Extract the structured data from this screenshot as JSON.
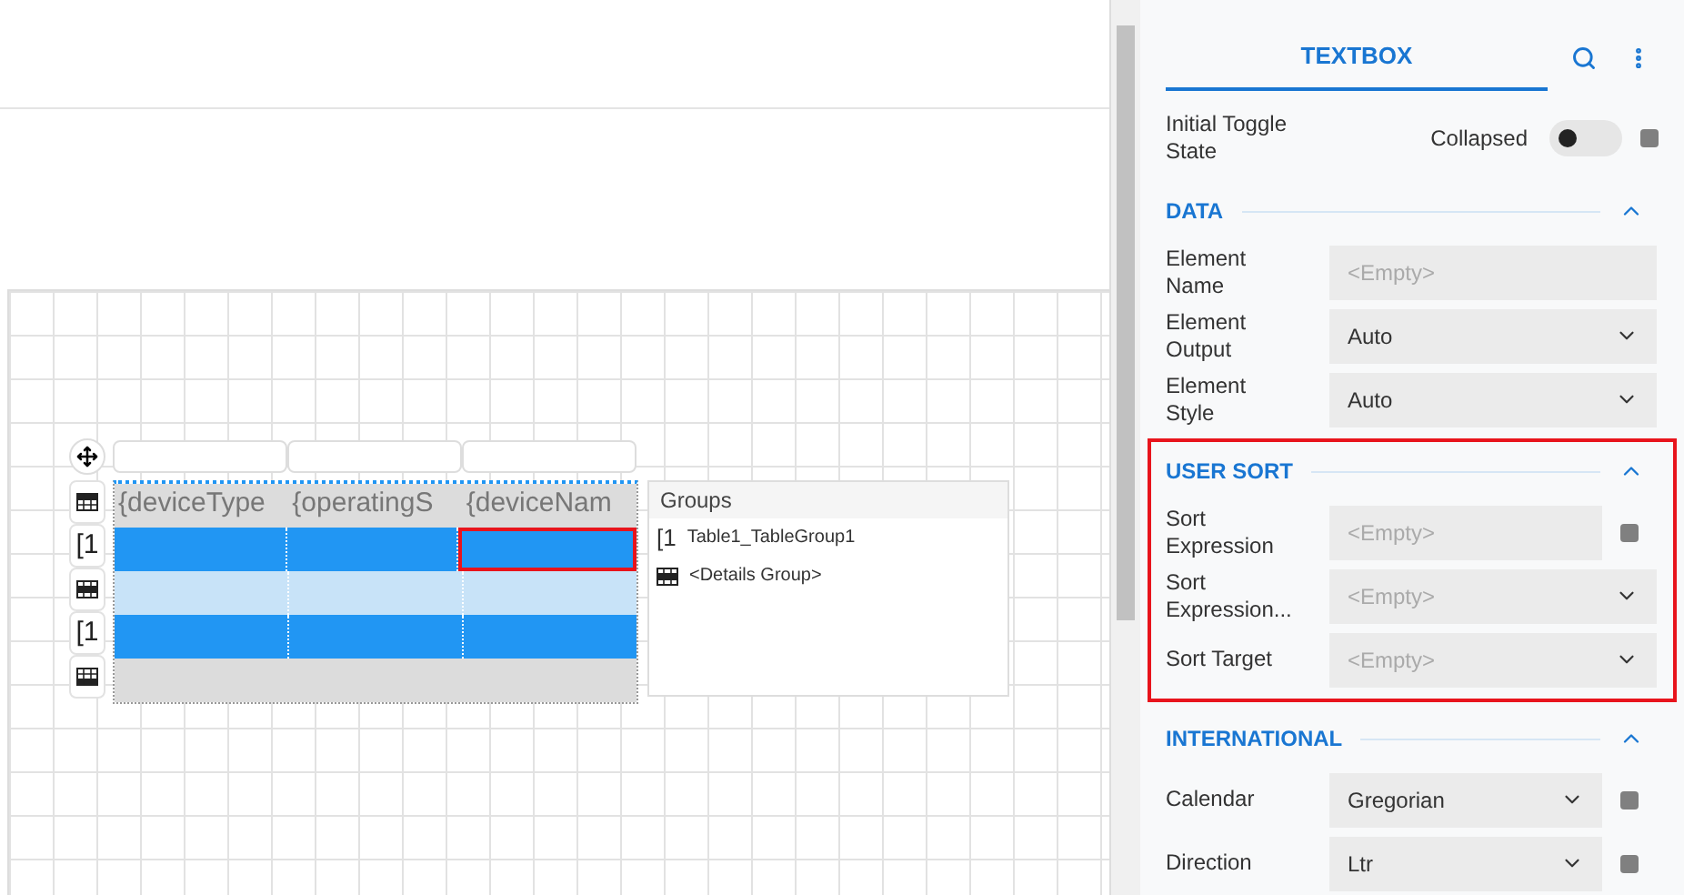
{
  "table": {
    "rows": [
      {
        "kind": "header",
        "cells": [
          {
            "text": "{deviceType",
            "selected": false
          },
          {
            "text": "{operatingS",
            "selected": false
          },
          {
            "text": "{deviceNam",
            "selected": false
          }
        ]
      },
      {
        "kind": "group",
        "handle": "[1",
        "cells": [
          {
            "selected": false
          },
          {
            "selected": false
          },
          {
            "selected": true
          }
        ]
      },
      {
        "kind": "details",
        "cells": [
          {
            "selected": false
          },
          {
            "selected": false
          },
          {
            "selected": false
          }
        ]
      },
      {
        "kind": "group",
        "handle": "[1",
        "cells": [
          {
            "selected": false
          },
          {
            "selected": false
          },
          {
            "selected": false
          }
        ]
      },
      {
        "kind": "footer",
        "cells": [
          {
            "selected": false
          },
          {
            "selected": false
          },
          {
            "selected": false
          }
        ]
      }
    ]
  },
  "groups": {
    "title": "Groups",
    "items": [
      {
        "kind": "group",
        "mark": "[1",
        "label": "Table1_TableGroup1"
      },
      {
        "kind": "details",
        "label": "<Details Group>"
      }
    ]
  },
  "panel": {
    "tab": "TEXTBOX",
    "toggle": {
      "label": "Initial Toggle State",
      "value": "Collapsed",
      "on": false
    },
    "sections": [
      {
        "title": "DATA",
        "expanded": true,
        "highlighted": false,
        "fields": [
          {
            "label": "Element Name",
            "kind": "text",
            "placeholder": "<Empty>",
            "expression": false
          },
          {
            "label": "Element Output",
            "kind": "select",
            "value": "Auto",
            "expression": false
          },
          {
            "label": "Element Style",
            "kind": "select",
            "value": "Auto",
            "expression": false
          }
        ]
      },
      {
        "title": "USER SORT",
        "expanded": true,
        "highlighted": true,
        "fields": [
          {
            "label": "Sort Expression",
            "kind": "text",
            "placeholder": "<Empty>",
            "expression": true
          },
          {
            "label": "Sort Expression...",
            "kind": "select",
            "placeholder": "<Empty>",
            "expression": false
          },
          {
            "label": "Sort Target",
            "kind": "select",
            "placeholder": "<Empty>",
            "expression": false
          }
        ]
      },
      {
        "title": "INTERNATIONAL",
        "expanded": true,
        "highlighted": false,
        "fields": [
          {
            "label": "Calendar",
            "kind": "select",
            "value": "Gregorian",
            "expression": true
          },
          {
            "label": "Direction",
            "kind": "select",
            "value": "Ltr",
            "expression": true
          }
        ]
      }
    ]
  }
}
